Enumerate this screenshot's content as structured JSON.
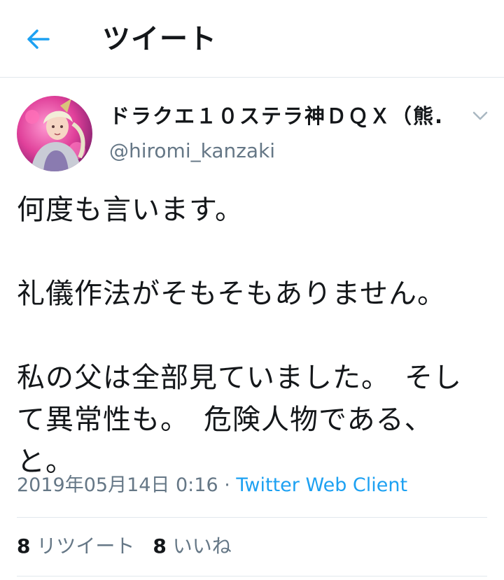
{
  "header": {
    "title": "ツイート",
    "back_icon": "arrow-left-icon",
    "accent_color": "#1da1f2"
  },
  "author": {
    "display_name": "ドラクエ１０ステラ神ＤＱＸ（熊...",
    "handle": "@hiromi_kanzaki",
    "menu_icon": "chevron-down-icon"
  },
  "tweet": {
    "text": "何度も言います。\n\n礼儀作法がそもそもありません。\n\n私の父は全部見ていました。　そして異常性も。　危険人物である、と。",
    "timestamp": "2019年05月14日 0:16",
    "separator": " · ",
    "client": "Twitter Web Client"
  },
  "stats": {
    "retweet_count": "8",
    "retweet_label": "リツイート",
    "like_count": "8",
    "like_label": "いいね"
  }
}
